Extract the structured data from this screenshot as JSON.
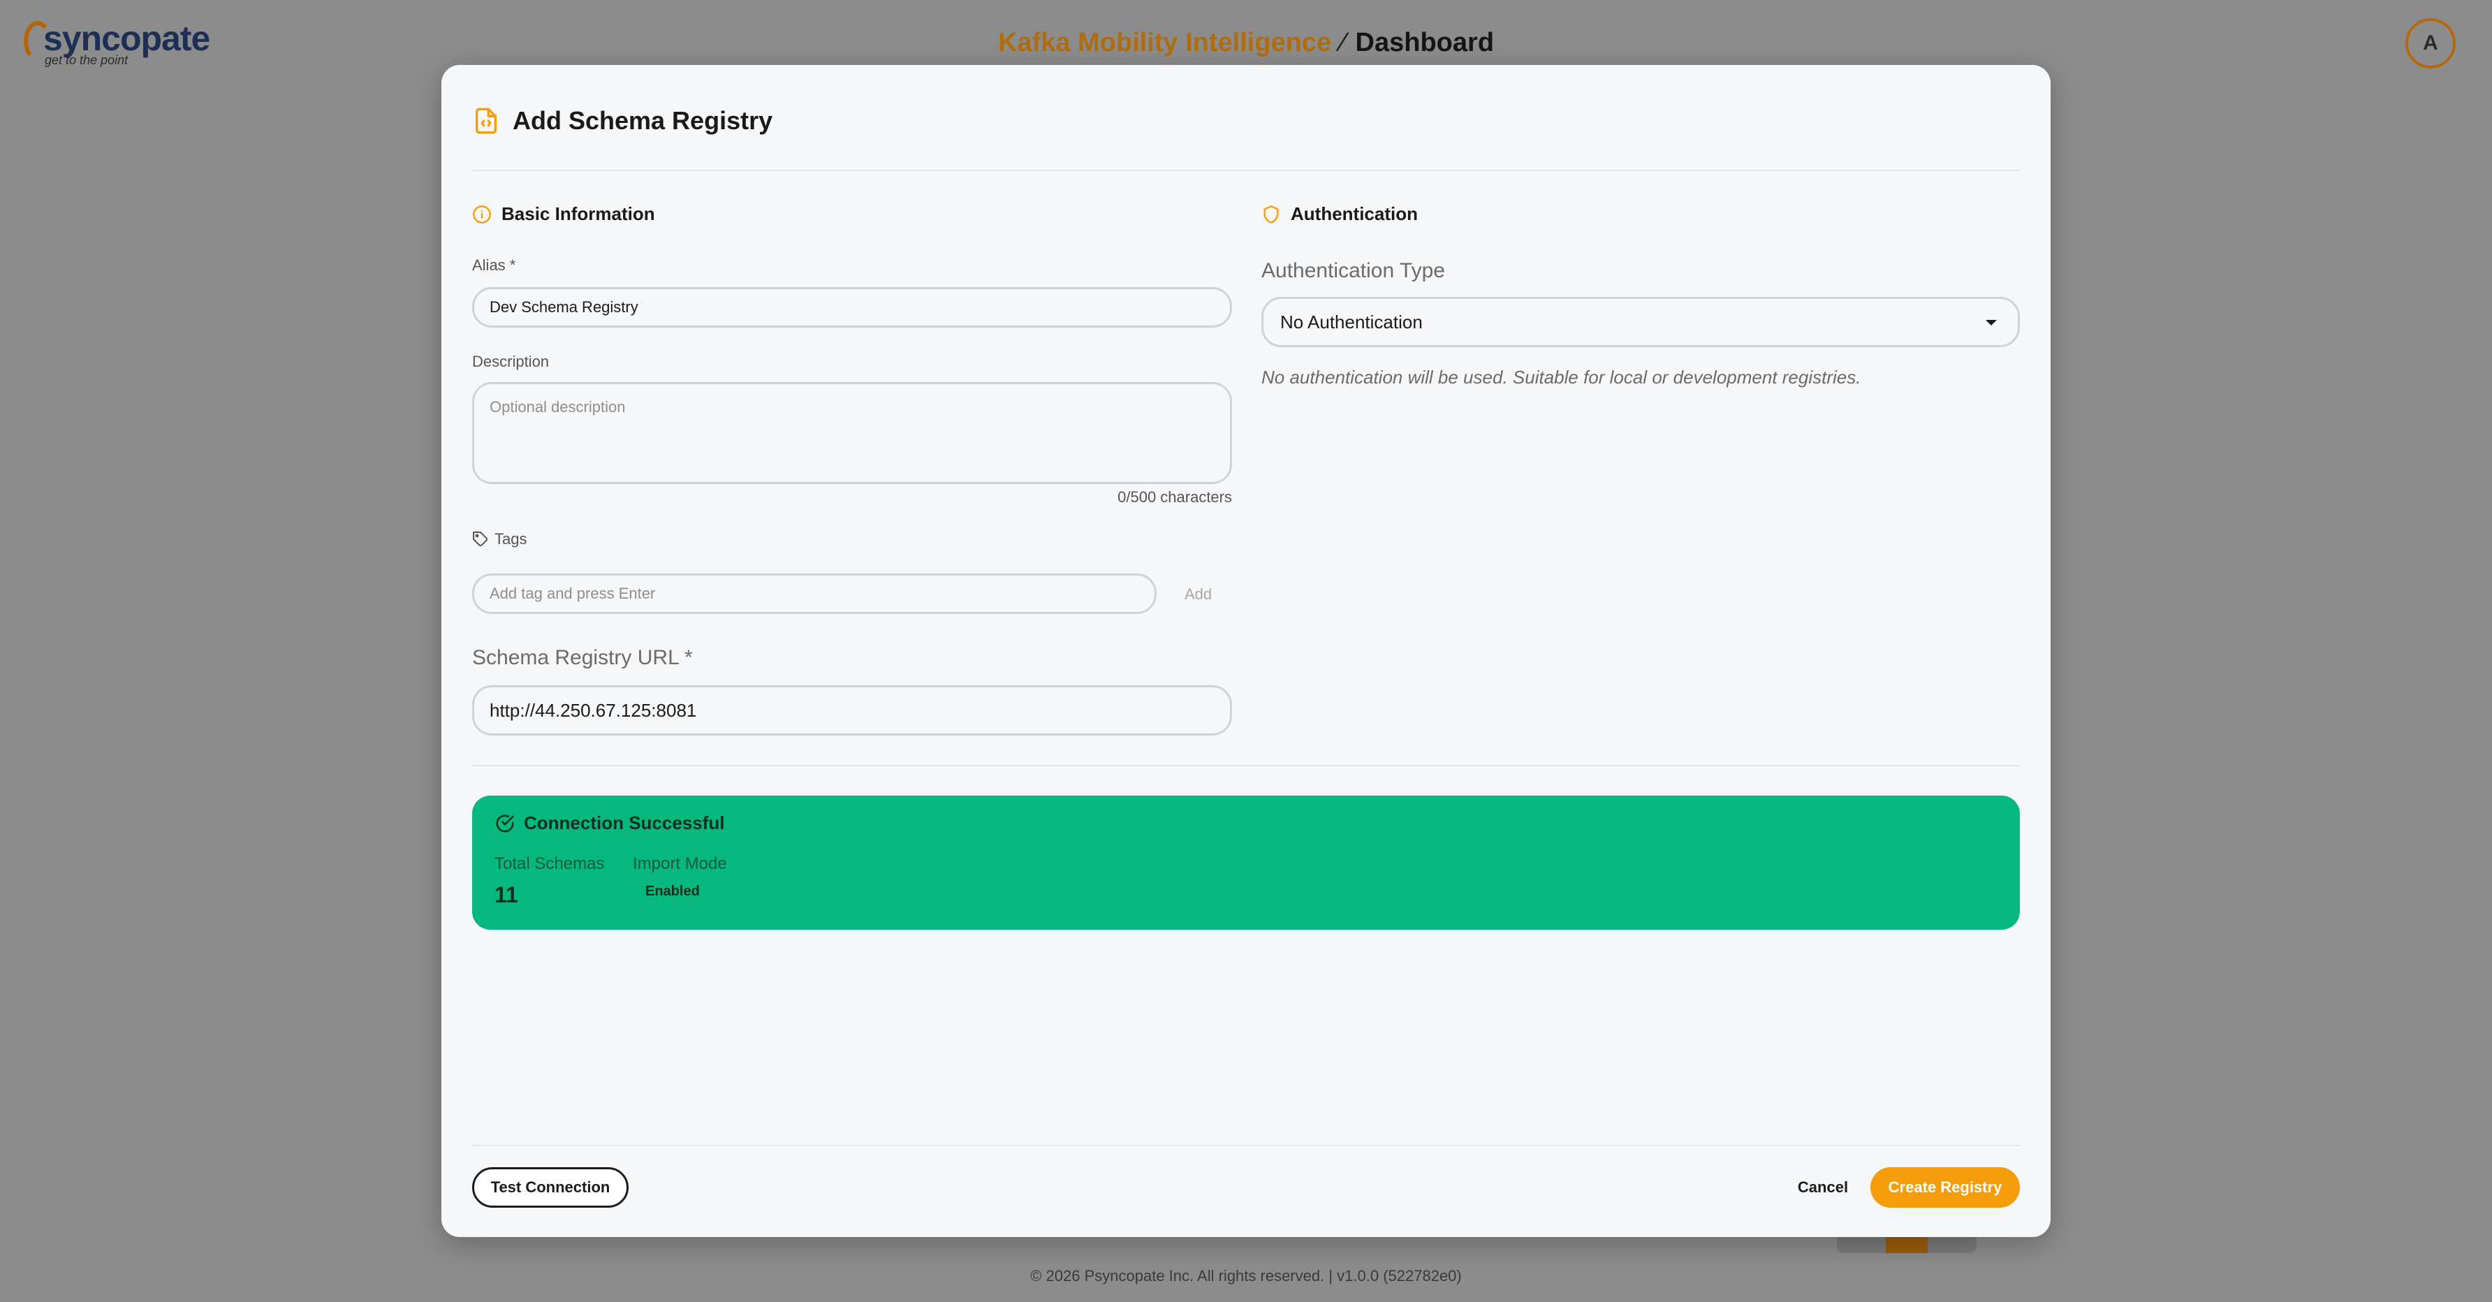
{
  "app": {
    "logo_word": "syncopate",
    "logo_tagline": "get to the point",
    "breadcrumb_parent": "Kafka Mobility Intelligence",
    "breadcrumb_separator": "⁄",
    "breadcrumb_current": "Dashboard",
    "avatar_initial": "A",
    "footer_text": "© 2026 Psyncopate Inc. All rights reserved. | v1.0.0 (522782e0)"
  },
  "modal": {
    "title": "Add Schema Registry",
    "basic": {
      "heading": "Basic Information",
      "alias_label": "Alias *",
      "alias_value": "Dev Schema Registry",
      "description_label": "Description",
      "description_placeholder": "Optional description",
      "char_count": "0/500 characters",
      "tags_label": "Tags",
      "tags_placeholder": "Add tag and press Enter",
      "add_label": "Add",
      "url_label": "Schema Registry URL *",
      "url_value": "http://44.250.67.125:8081"
    },
    "auth": {
      "heading": "Authentication",
      "type_label": "Authentication Type",
      "type_value": "No Authentication",
      "hint": "No authentication will be used. Suitable for local or development registries."
    },
    "connection": {
      "heading": "Connection Successful",
      "total_schemas_label": "Total Schemas",
      "total_schemas_value": "11",
      "import_mode_label": "Import Mode",
      "import_mode_value": "Enabled"
    },
    "footer": {
      "test_label": "Test Connection",
      "cancel_label": "Cancel",
      "create_label": "Create Registry"
    }
  },
  "colors": {
    "accent": "#f59c0b",
    "success": "#06b87d",
    "brand_navy": "#1e2f55",
    "overlay": "#8c8c8c"
  },
  "icons": {
    "title": "file-code-icon",
    "basic": "info-circle-icon",
    "auth": "shield-icon",
    "tags": "tag-icon",
    "success": "check-circle-icon",
    "select": "caret-down-icon"
  }
}
